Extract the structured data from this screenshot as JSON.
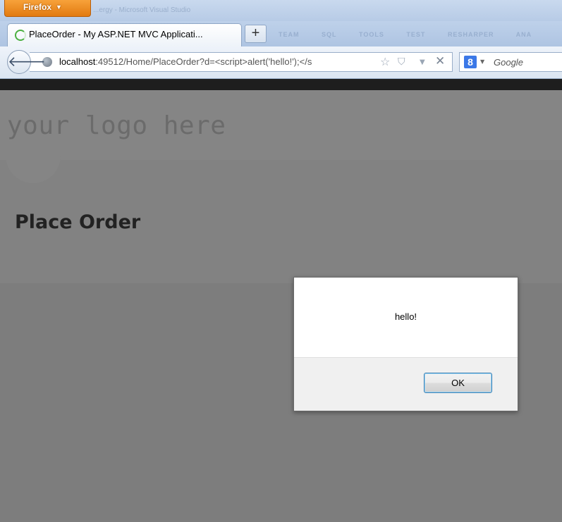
{
  "browser": {
    "app_button_label": "Firefox",
    "titlebar_ghost_text": "...ergy - Microsoft Visual Studio",
    "ghost_menu": [
      "TEAM",
      "SQL",
      "TOOLS",
      "TEST",
      "RESHARPER",
      "ANA"
    ],
    "tab": {
      "title": "PlaceOrder - My ASP.NET MVC Applicati..."
    },
    "new_tab_label": "+",
    "url": {
      "host": "localhost",
      "rest": ":49512/Home/PlaceOrder?d=<script>alert('hello!');</s"
    },
    "search": {
      "engine_letter": "8",
      "placeholder": "Google"
    }
  },
  "page": {
    "logo_text": "your logo here",
    "title": "Place Order"
  },
  "alert": {
    "message": "hello!",
    "ok_label": "OK"
  }
}
